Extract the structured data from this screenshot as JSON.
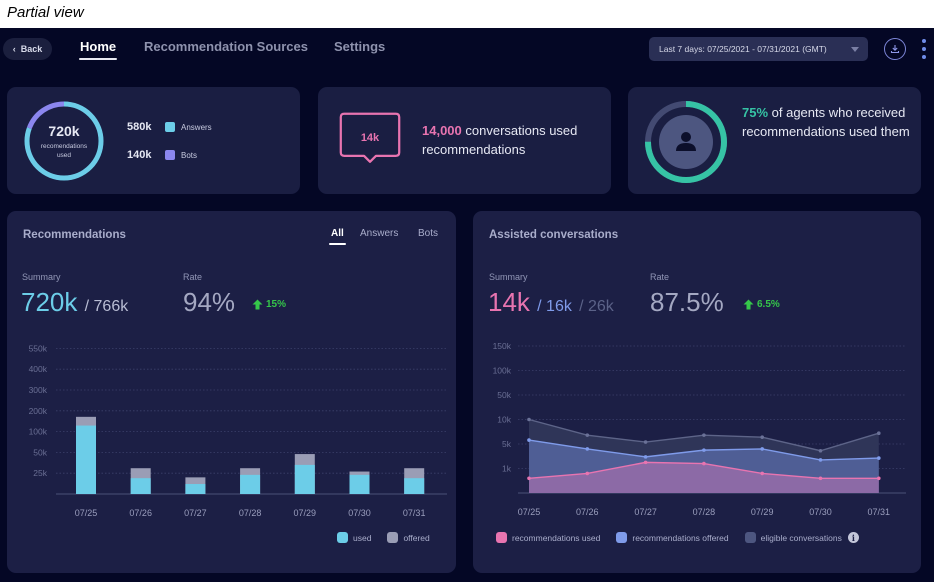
{
  "caption": "Partial view",
  "header": {
    "back_label": "Back",
    "tabs": [
      {
        "label": "Home",
        "active": true
      },
      {
        "label": "Recommendation Sources",
        "active": false
      },
      {
        "label": "Settings",
        "active": false
      }
    ],
    "date_range": "Last 7 days: 07/25/2021 - 07/31/2021 (GMT)",
    "icons": {
      "back": "chevron-left-icon",
      "download": "download-icon",
      "more": "more-vertical-icon",
      "date_caret": "caret-down-icon"
    }
  },
  "colors": {
    "answers": "#6ccde8",
    "bots": "#8b86ee",
    "pink": "#e874b0",
    "teal": "#36c3a5",
    "blue": "#7f9bea",
    "gray_series": "#4d5680",
    "offered_bar": "#9a9db5",
    "green": "#35c74a"
  },
  "summary_cards": {
    "recommendations": {
      "total_value": "720k",
      "total_label": "recomendations used",
      "answers_value": "580k",
      "answers_label": "Answers",
      "answers_share": 0.8056,
      "bots_value": "140k",
      "bots_label": "Bots",
      "bots_share": 0.1944
    },
    "conversations": {
      "bubble_value": "14k",
      "highlight": "14,000",
      "text": " conversations used recommendations"
    },
    "agents": {
      "icon": "user-icon",
      "highlight": "75%",
      "text": " of agents who received recommendations used them",
      "ratio": 0.75
    }
  },
  "recommendations_panel": {
    "title": "Recommendations",
    "tabs": [
      {
        "label": "All",
        "active": true
      },
      {
        "label": "Answers",
        "active": false
      },
      {
        "label": "Bots",
        "active": false
      }
    ],
    "summary_label": "Summary",
    "summary_value": "720k",
    "summary_total": "/ 766k",
    "rate_label": "Rate",
    "rate_value": "94%",
    "delta": "15%",
    "legend": [
      {
        "label": "used"
      },
      {
        "label": "offered"
      }
    ]
  },
  "assisted_panel": {
    "title": "Assisted conversations",
    "summary_label": "Summary",
    "summary_value": "14k",
    "summary_offered": "/ 16k",
    "summary_total": "/ 26k",
    "rate_label": "Rate",
    "rate_value": "87.5%",
    "delta": "6.5%",
    "legend": [
      {
        "label": "recommendations used"
      },
      {
        "label": "recommendations offered"
      },
      {
        "label": "eligible conversations"
      }
    ]
  },
  "chart_data": [
    {
      "type": "bar",
      "title": "Recommendations",
      "stacked": true,
      "categories": [
        "07/25",
        "07/26",
        "07/27",
        "07/28",
        "07/29",
        "07/30",
        "07/31"
      ],
      "yticks": [
        0,
        25000,
        50000,
        100000,
        200000,
        300000,
        400000,
        550000
      ],
      "ytick_labels": [
        "",
        "25k",
        "50k",
        "100k",
        "200k",
        "300k",
        "400k",
        "550k"
      ],
      "ylim": [
        0,
        550000
      ],
      "grid": true,
      "legend_position": "bottom-right",
      "series": [
        {
          "name": "used",
          "values": [
            129000,
            19000,
            12000,
            23000,
            35000,
            23000,
            19000
          ]
        },
        {
          "name": "offered",
          "values": [
            171000,
            31000,
            20000,
            31000,
            48000,
            27000,
            31000
          ]
        }
      ]
    },
    {
      "type": "area",
      "title": "Assisted conversations",
      "categories": [
        "07/25",
        "07/26",
        "07/27",
        "07/28",
        "07/29",
        "07/30",
        "07/31"
      ],
      "yticks": [
        0,
        1000,
        5000,
        10000,
        50000,
        100000,
        150000
      ],
      "ytick_labels": [
        "",
        "1k",
        "5k",
        "10k",
        "50k",
        "100k",
        "150k"
      ],
      "ylim": [
        0,
        150000
      ],
      "grid": true,
      "legend_position": "bottom",
      "series": [
        {
          "name": "eligible conversations",
          "values": [
            10000,
            6800,
            5400,
            6800,
            6400,
            3900,
            7200
          ]
        },
        {
          "name": "recommendations offered",
          "values": [
            5800,
            4200,
            2900,
            4000,
            4200,
            2400,
            2700
          ]
        },
        {
          "name": "recommendations used",
          "values": [
            600,
            800,
            2000,
            1800,
            800,
            600,
            600
          ]
        }
      ]
    }
  ]
}
